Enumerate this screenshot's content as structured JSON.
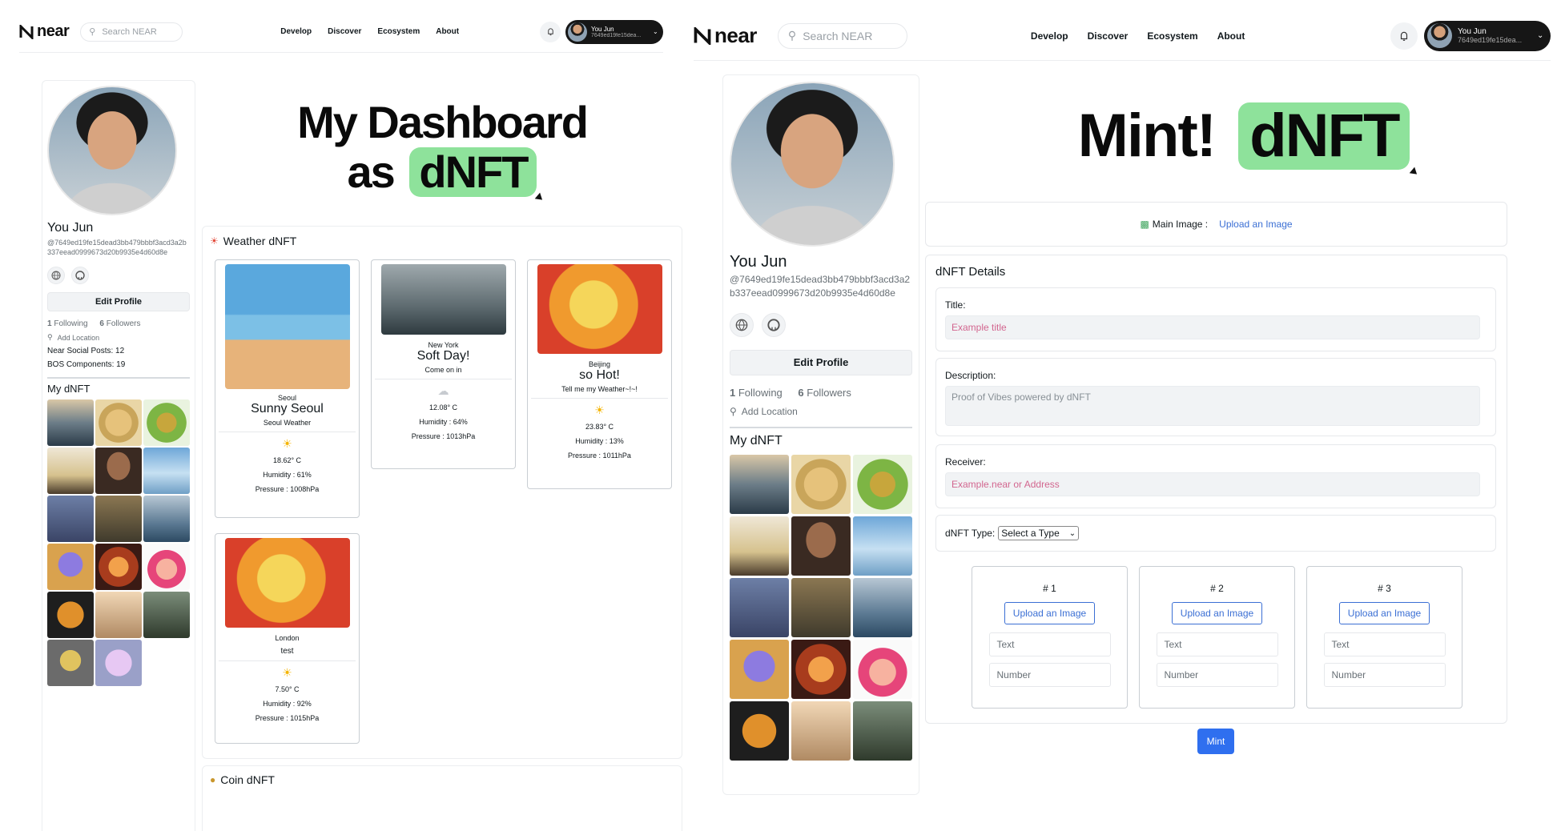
{
  "nav": {
    "logo_text": "near",
    "search_placeholder": "Search NEAR",
    "links": [
      "Develop",
      "Discover",
      "Ecosystem",
      "About"
    ],
    "user_name": "You Jun",
    "user_short_address": "7649ed19fe15dea..."
  },
  "profile": {
    "name": "You Jun",
    "address": "@7649ed19fe15dead3bb479bbbf3acd3a2b337eead0999673d20b9935e4d60d8e",
    "edit_label": "Edit Profile",
    "following_count": "1",
    "following_label": "Following",
    "followers_count": "6",
    "followers_label": "Followers",
    "add_location": "Add Location",
    "posts": "Near Social Posts: 12",
    "components": "BOS Components: 19",
    "my_dnft": "My dNFT"
  },
  "dashboard": {
    "title_line1": "My Dashboard",
    "title_prefix": "as",
    "title_highlight": "dNFT",
    "weather_section": "Weather dNFT",
    "coin_section": "Coin dNFT",
    "weather": [
      {
        "city": "Seoul",
        "title": "Sunny Seoul",
        "sub": "Seoul Weather",
        "icon": "sun",
        "temp": "18.62° C",
        "humidity": "Humidity : 61%",
        "pressure": "Pressure : 1008hPa"
      },
      {
        "city": "New York",
        "title": "Soft Day!",
        "sub": "Come on in",
        "icon": "cloud",
        "temp": "12.08° C",
        "humidity": "Humidity : 64%",
        "pressure": "Pressure : 1013hPa"
      },
      {
        "city": "Beijing",
        "title": "so Hot!",
        "sub": "Tell me my Weather~!~!",
        "icon": "sun",
        "temp": "23.83° C",
        "humidity": "Humidity : 13%",
        "pressure": "Pressure : 1011hPa"
      },
      {
        "city": "London",
        "title": "test",
        "sub": "",
        "icon": "sun",
        "temp": "7.50° C",
        "humidity": "Humidity : 92%",
        "pressure": "Pressure : 1015hPa"
      }
    ]
  },
  "mint": {
    "title_word": "Mint!",
    "title_highlight": "dNFT",
    "main_image_label": "Main Image :",
    "main_image_link": "Upload an Image",
    "details_title": "dNFT Details",
    "title_label": "Title:",
    "title_placeholder": "Example title",
    "description_label": "Description:",
    "description_placeholder": "Proof of Vibes powered by dNFT",
    "receiver_label": "Receiver:",
    "receiver_placeholder": "Example.near or Address",
    "type_label": "dNFT Type:",
    "type_selected": "Select a Type",
    "slots": [
      {
        "no": "# 1",
        "upload": "Upload an Image",
        "text": "Text",
        "number": "Number"
      },
      {
        "no": "# 2",
        "upload": "Upload an Image",
        "text": "Text",
        "number": "Number"
      },
      {
        "no": "# 3",
        "upload": "Upload an Image",
        "text": "Text",
        "number": "Number"
      }
    ],
    "mint_button": "Mint"
  }
}
